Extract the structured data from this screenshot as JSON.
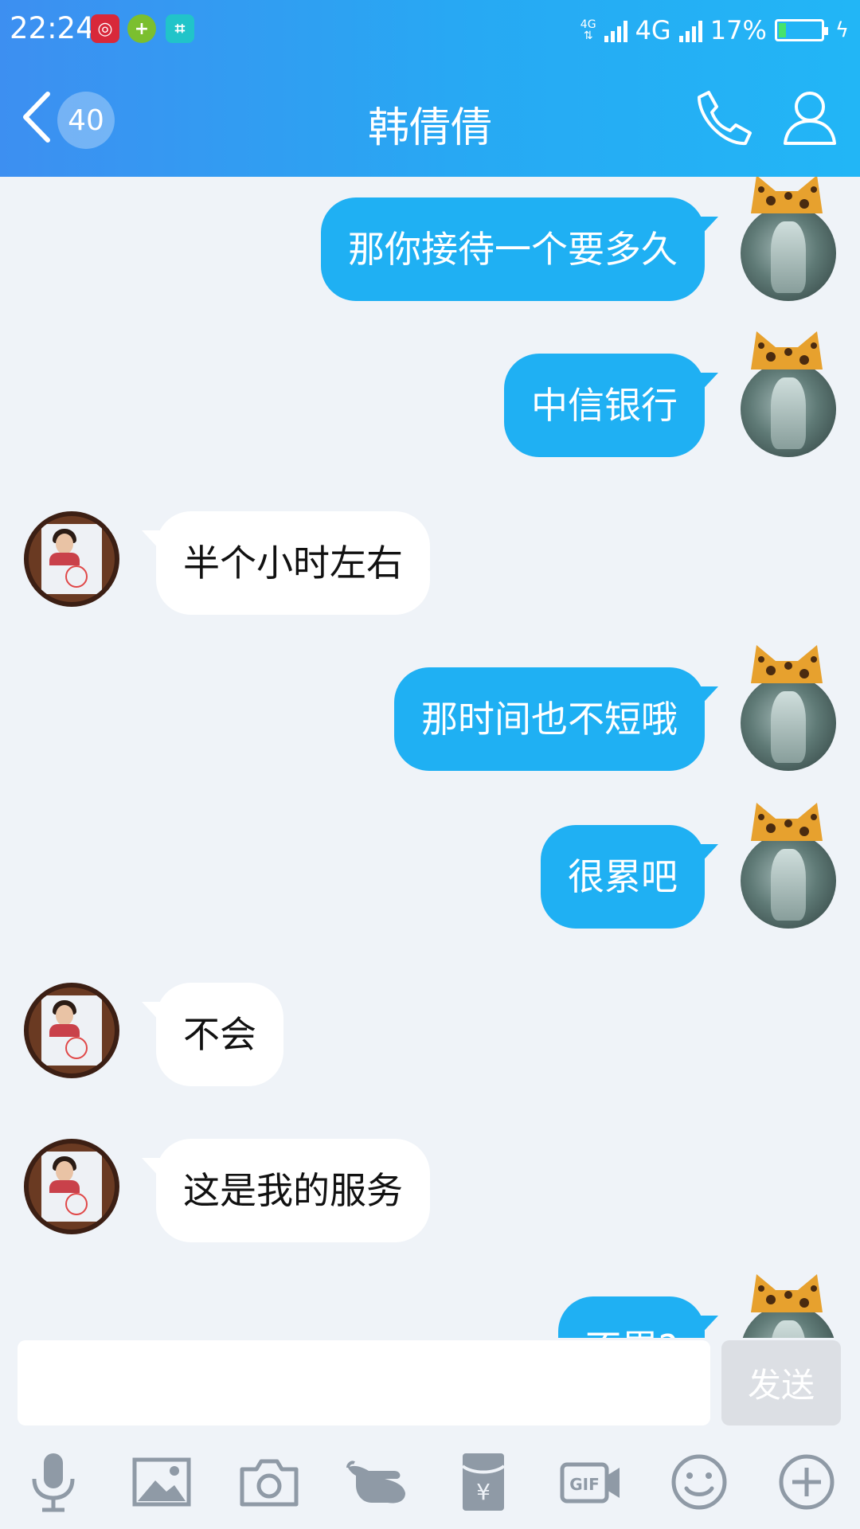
{
  "status_bar": {
    "time": "22:24",
    "network_small": "4G",
    "network": "4G",
    "battery": "17%",
    "battery_level_percent": 17
  },
  "header": {
    "unread_count": "40",
    "contact_name": "韩倩倩"
  },
  "messages": [
    {
      "sender": "me",
      "text": "那你接待一个要多久"
    },
    {
      "sender": "me",
      "text": "中信银行"
    },
    {
      "sender": "contact",
      "text": "半个小时左右"
    },
    {
      "sender": "me",
      "text": "那时间也不短哦"
    },
    {
      "sender": "me",
      "text": "很累吧"
    },
    {
      "sender": "contact",
      "text": "不会"
    },
    {
      "sender": "contact",
      "text": "这是我的服务"
    },
    {
      "sender": "me",
      "text": "不累?"
    }
  ],
  "input": {
    "value": "",
    "send_label": "发送"
  },
  "toolbar_icons": [
    "microphone-icon",
    "image-icon",
    "camera-icon",
    "hand-point-icon",
    "red-packet-icon",
    "gif-icon",
    "emoji-icon",
    "plus-icon"
  ],
  "colors": {
    "header_start": "#3d8ff1",
    "header_end": "#22b6f6",
    "bubble_out": "#1fb0f3",
    "bubble_in": "#ffffff",
    "chat_bg": "#eff3f8"
  }
}
